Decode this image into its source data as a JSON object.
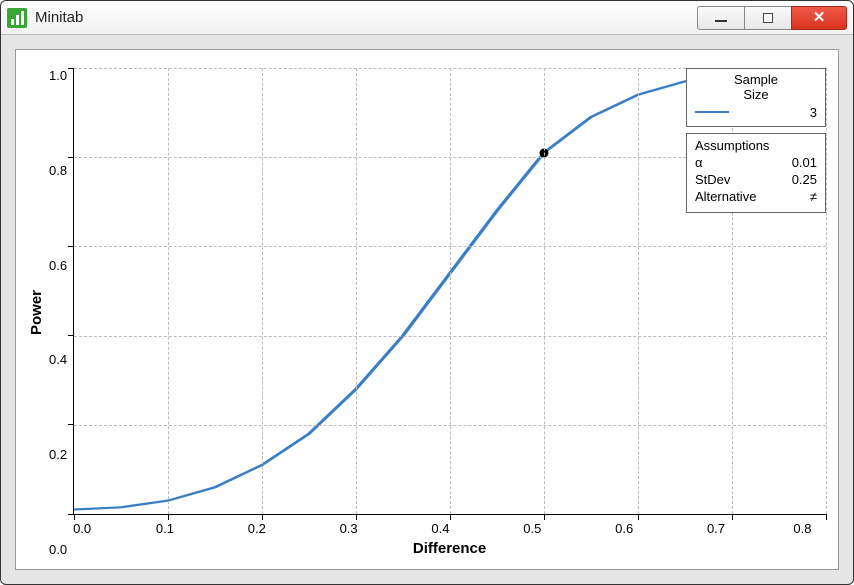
{
  "window": {
    "title": "Minitab"
  },
  "chart_data": {
    "type": "line",
    "xlabel": "Difference",
    "ylabel": "Power",
    "xlim": [
      0.0,
      0.8
    ],
    "ylim": [
      0.0,
      1.0
    ],
    "x_ticks": [
      "0.0",
      "0.1",
      "0.2",
      "0.3",
      "0.4",
      "0.5",
      "0.6",
      "0.7",
      "0.8"
    ],
    "y_ticks": [
      "1.0",
      "0.8",
      "0.6",
      "0.4",
      "0.2",
      "0.0"
    ],
    "series": [
      {
        "name": "Sample Size 3",
        "color": "#3a7fc4",
        "x": [
          0.0,
          0.05,
          0.1,
          0.15,
          0.2,
          0.25,
          0.3,
          0.35,
          0.4,
          0.45,
          0.5,
          0.55,
          0.6,
          0.65,
          0.7,
          0.75,
          0.8
        ],
        "values": [
          0.01,
          0.015,
          0.03,
          0.06,
          0.11,
          0.18,
          0.28,
          0.4,
          0.54,
          0.68,
          0.81,
          0.89,
          0.94,
          0.97,
          0.985,
          0.992,
          0.998
        ]
      }
    ],
    "marker": {
      "x": 0.5,
      "y": 0.81
    }
  },
  "legend": {
    "title_line1": "Sample",
    "title_line2": "Size",
    "value": "3"
  },
  "assumptions": {
    "heading": "Assumptions",
    "rows": [
      {
        "label": "α",
        "value": "0.01"
      },
      {
        "label": "StDev",
        "value": "0.25"
      },
      {
        "label": "Alternative",
        "value": "≠"
      }
    ]
  }
}
